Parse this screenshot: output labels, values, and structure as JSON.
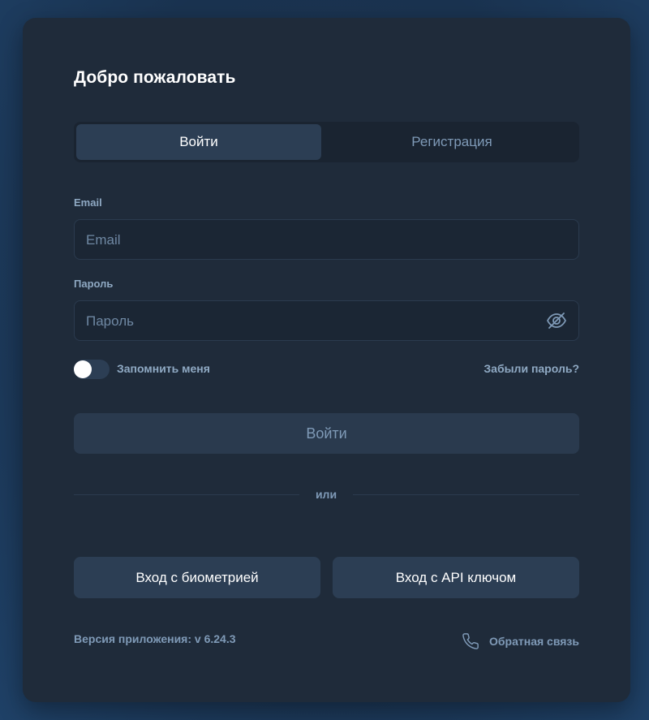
{
  "auth": {
    "title": "Добро пожаловать",
    "tabs": [
      {
        "label": "Войти",
        "active": true
      },
      {
        "label": "Регистрация",
        "active": false
      }
    ],
    "email": {
      "label": "Email",
      "placeholder": "Email",
      "value": ""
    },
    "password": {
      "label": "Пароль",
      "placeholder": "Пароль",
      "value": "",
      "visibility_icon": "eye-off-icon"
    },
    "remember_me": {
      "label": "Запомнить меня",
      "checked": false
    },
    "forgot_password": "Забыли пароль?",
    "submit_label": "Войти",
    "divider_text": "или",
    "alt_login": {
      "biometric": "Вход с биометрией",
      "api_key": "Вход с API ключом"
    },
    "footer": {
      "version": "Версия приложения: v 6.24.3",
      "feedback": "Обратная связь",
      "feedback_icon": "phone-icon"
    }
  },
  "colors": {
    "background": "#1a3350",
    "card": "#1f2b3a",
    "input_bg": "#1b2634",
    "button_bg": "#2c3e54",
    "muted_text": "#7f9ab7",
    "label_text": "#8fa9c3"
  }
}
